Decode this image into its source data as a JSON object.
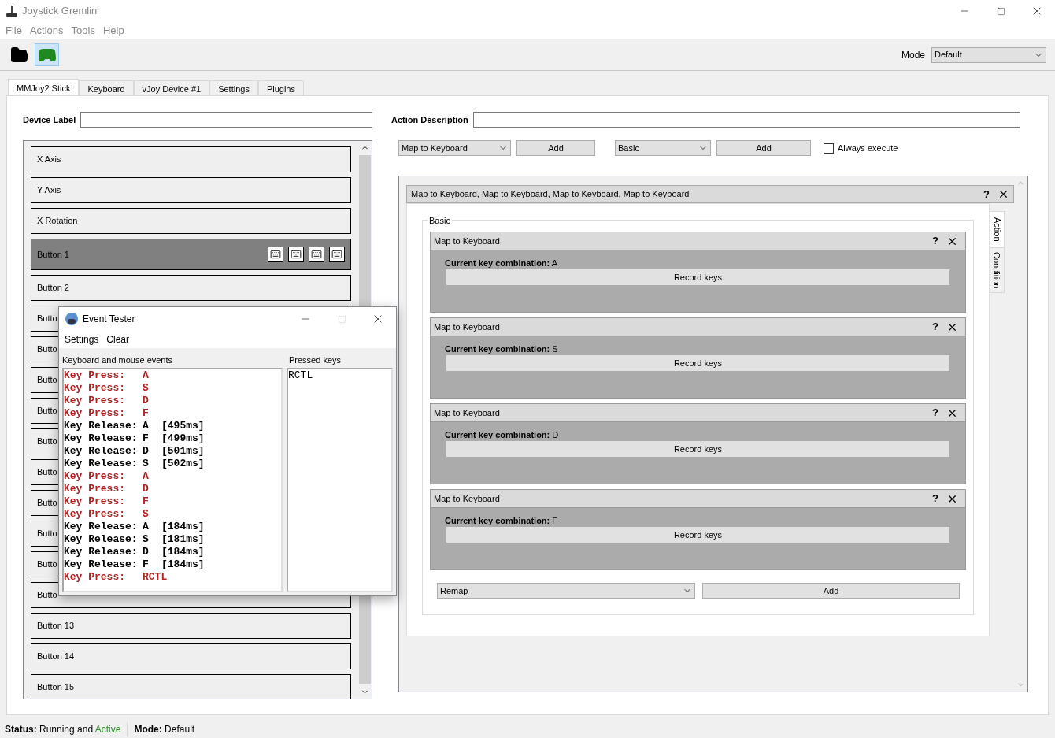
{
  "window": {
    "title": "Joystick Gremlin"
  },
  "menu": [
    "File",
    "Actions",
    "Tools",
    "Help"
  ],
  "toolbar": {
    "buttons": [
      {
        "kind": "open",
        "selected": false
      },
      {
        "kind": "gamepad",
        "selected": true
      }
    ],
    "mode_label": "Mode",
    "mode_value": "Default"
  },
  "tabs": [
    {
      "label": "MMJoy2 Stick",
      "selected": true
    },
    {
      "label": "Keyboard",
      "selected": false
    },
    {
      "label": "vJoy Device #1",
      "selected": false
    },
    {
      "label": "Settings",
      "selected": false
    },
    {
      "label": "Plugins",
      "selected": false
    }
  ],
  "device_label": {
    "label": "Device Label"
  },
  "inputs": [
    {
      "label": "X Axis",
      "selected": false
    },
    {
      "label": "Y Axis",
      "selected": false
    },
    {
      "label": "X Rotation",
      "selected": false
    },
    {
      "label": "Button 1",
      "selected": true,
      "actions": [
        {
          "kind": "keyboard"
        },
        {
          "kind": "keyboard"
        },
        {
          "kind": "keyboard"
        },
        {
          "kind": "keyboard"
        }
      ]
    },
    {
      "label": "Button 2",
      "selected": false
    },
    {
      "label": "Butto",
      "selected": false
    },
    {
      "label": "Butto",
      "selected": false
    },
    {
      "label": "Butto",
      "selected": false
    },
    {
      "label": "Butto",
      "selected": false
    },
    {
      "label": "Butto",
      "selected": false
    },
    {
      "label": "Butto",
      "selected": false
    },
    {
      "label": "Butto",
      "selected": false
    },
    {
      "label": "Butto",
      "selected": false
    },
    {
      "label": "Butto",
      "selected": false
    },
    {
      "label": "Butto",
      "selected": false
    },
    {
      "label": "Button 13",
      "selected": false
    },
    {
      "label": "Button 14",
      "selected": false
    },
    {
      "label": "Button 15",
      "selected": false
    }
  ],
  "action_description": {
    "label": "Action Description"
  },
  "action_bar": {
    "action_select": "Map to Keyboard",
    "action_add": "Add",
    "condition_select": "Basic",
    "condition_add": "Add",
    "always_execute": {
      "label": "Always execute",
      "checked": false
    }
  },
  "container": {
    "help": "?",
    "title": "Map to Keyboard, Map to Keyboard, Map to Keyboard, Map to Keyboard",
    "group_label": "Basic",
    "side_tabs": [
      {
        "label": "Action",
        "selected": true
      },
      {
        "label": "Condition",
        "selected": false
      }
    ],
    "actions": [
      {
        "title": "Map to Keyboard",
        "help": "?",
        "combination_label": "Current key combination:",
        "key": "A",
        "button": "Record keys"
      },
      {
        "title": "Map to Keyboard",
        "help": "?",
        "combination_label": "Current key combination:",
        "key": "S",
        "button": "Record keys"
      },
      {
        "title": "Map to Keyboard",
        "help": "?",
        "combination_label": "Current key combination:",
        "key": "D",
        "button": "Record keys"
      },
      {
        "title": "Map to Keyboard",
        "help": "?",
        "combination_label": "Current key combination:",
        "key": "F",
        "button": "Record keys"
      }
    ],
    "footer_select": "Remap",
    "footer_add": "Add"
  },
  "status_bar": {
    "status_label": "Status:",
    "status_text": "Running and",
    "status_active": "Active",
    "mode_label": "Mode:",
    "mode_value": "Default"
  },
  "event_tester": {
    "title": "Event Tester",
    "menu": [
      "Settings",
      "Clear"
    ],
    "events_label": "Keyboard and mouse events",
    "pressed_label": "Pressed keys",
    "events": [
      {
        "kind": "press",
        "label": "Key Press:",
        "key": "A"
      },
      {
        "kind": "press",
        "label": "Key Press:",
        "key": "S"
      },
      {
        "kind": "press",
        "label": "Key Press:",
        "key": "D"
      },
      {
        "kind": "press",
        "label": "Key Press:",
        "key": "F"
      },
      {
        "kind": "release",
        "label": "Key Release:",
        "key": "A",
        "time": "[495ms]"
      },
      {
        "kind": "release",
        "label": "Key Release:",
        "key": "F",
        "time": "[499ms]"
      },
      {
        "kind": "release",
        "label": "Key Release:",
        "key": "D",
        "time": "[501ms]"
      },
      {
        "kind": "release",
        "label": "Key Release:",
        "key": "S",
        "time": "[502ms]"
      },
      {
        "kind": "press",
        "label": "Key Press:",
        "key": "A"
      },
      {
        "kind": "press",
        "label": "Key Press:",
        "key": "D"
      },
      {
        "kind": "press",
        "label": "Key Press:",
        "key": "F"
      },
      {
        "kind": "press",
        "label": "Key Press:",
        "key": "S"
      },
      {
        "kind": "release",
        "label": "Key Release:",
        "key": "A",
        "time": "[184ms]"
      },
      {
        "kind": "release",
        "label": "Key Release:",
        "key": "S",
        "time": "[181ms]"
      },
      {
        "kind": "release",
        "label": "Key Release:",
        "key": "D",
        "time": "[184ms]"
      },
      {
        "kind": "release",
        "label": "Key Release:",
        "key": "F",
        "time": "[184ms]"
      },
      {
        "kind": "press",
        "label": "Key Press:",
        "key": "RCTL"
      }
    ],
    "pressed": [
      "RCTL"
    ]
  }
}
